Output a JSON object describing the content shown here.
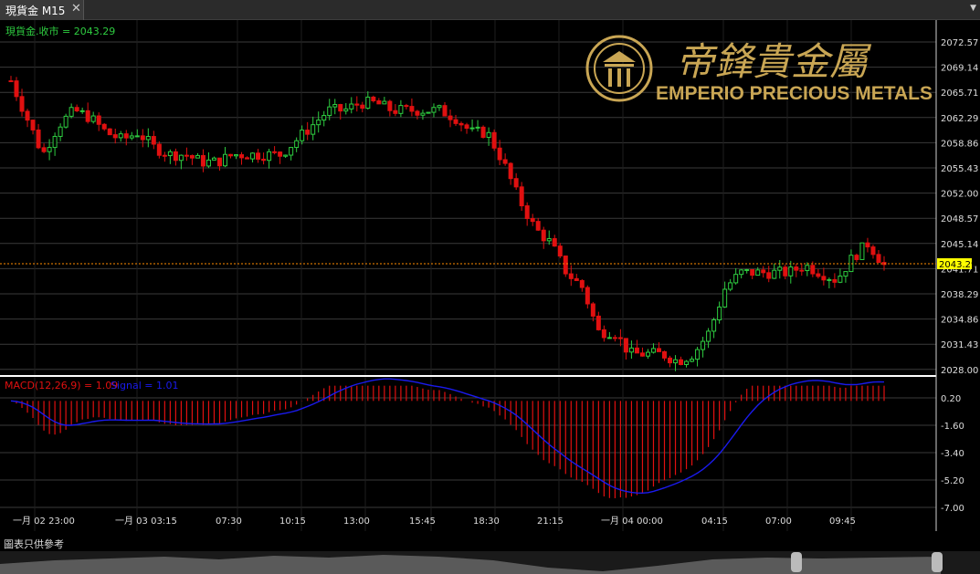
{
  "tab": {
    "title": "現貨金 M15",
    "close_label": "✕"
  },
  "menu_icon": "chevron-down-icon",
  "price_label": "現貨金.收市 = 2043.29",
  "current_price": "2043.29",
  "logo": {
    "chinese": "帝鋒貴金屬",
    "english": "EMPERIO PRECIOUS METALS"
  },
  "price_axis": [
    "2072.57",
    "2069.14",
    "2065.71",
    "2062.29",
    "2058.86",
    "2055.43",
    "2052.00",
    "2048.57",
    "2045.14",
    "2041.71",
    "2038.29",
    "2034.86",
    "2031.43",
    "2028.00"
  ],
  "macd_label": "MACD(12,26,9) = 1.09",
  "signal_label": "Signal = 1.01",
  "macd_axis": [
    "0.20",
    "-1.60",
    "-3.40",
    "-5.20",
    "-7.00"
  ],
  "time_axis": [
    "一月 02 23:00",
    "一月 03 03:15",
    "07:30",
    "10:15",
    "13:00",
    "15:45",
    "18:30",
    "21:15",
    "一月 04 00:00",
    "04:15",
    "07:00",
    "09:45"
  ],
  "footer_note": "圖表只供參考",
  "colors": {
    "up": "#2ecc40",
    "down": "#e01010",
    "macd_hist": "#e01010",
    "signal": "#1a1aee",
    "grid": "#3a3a3a",
    "gold": "#c9a654",
    "current_line": "#ff8c00",
    "current_bg": "#ffff00"
  },
  "chart_data": {
    "type": "candlestick",
    "title": "現貨金 M15",
    "ylim": [
      2028.0,
      2074.0
    ],
    "close_path": [
      2068,
      2063,
      2058,
      2062,
      2064,
      2063,
      2061,
      2060,
      2061,
      2059,
      2058,
      2058,
      2057,
      2057,
      2058,
      2058,
      2058,
      2058,
      2060,
      2062,
      2064,
      2064,
      2065,
      2065,
      2064,
      2064,
      2064,
      2064,
      2063,
      2061,
      2061,
      2057,
      2052,
      2048,
      2046,
      2042,
      2040,
      2034,
      2034,
      2031,
      2031,
      2031,
      2030,
      2031,
      2034,
      2040,
      2042,
      2042,
      2042,
      2042,
      2043,
      2042,
      2041,
      2044,
      2046,
      2043
    ],
    "macd_ylim": [
      -7.0,
      1.0
    ]
  }
}
